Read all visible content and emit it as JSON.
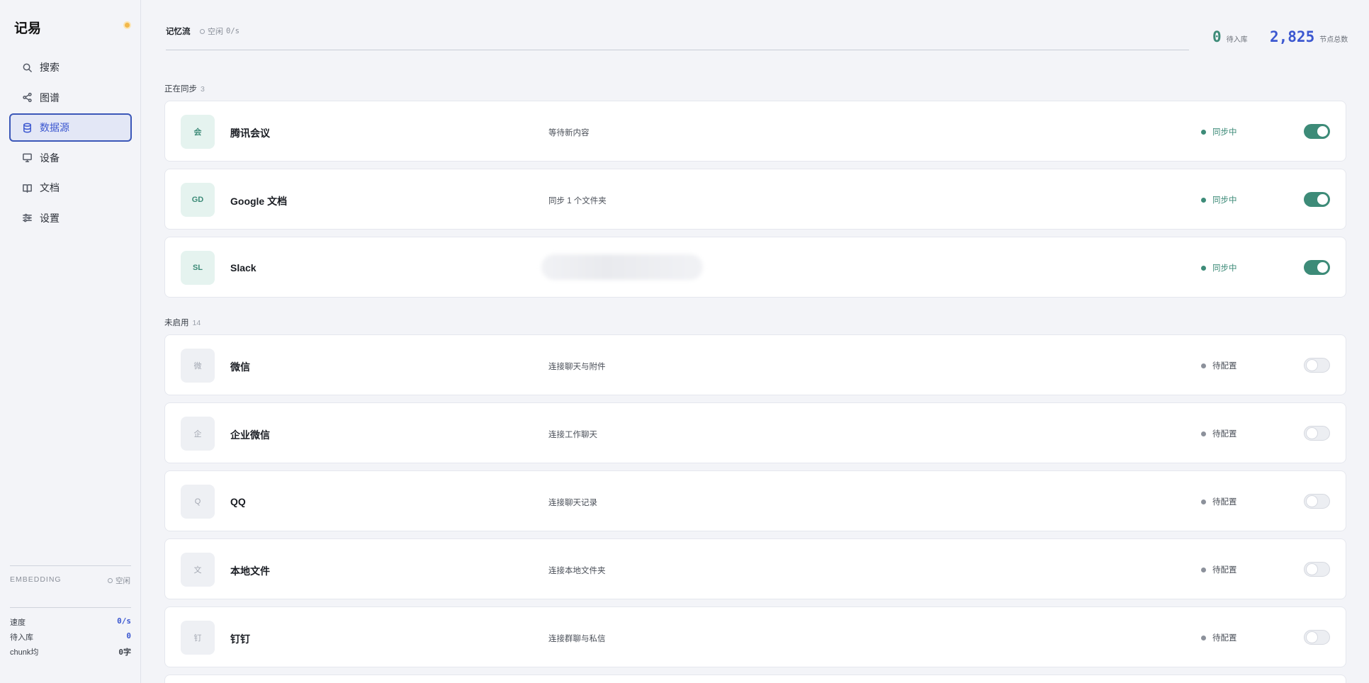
{
  "app": {
    "title": "记易"
  },
  "nav": [
    {
      "label": "搜索",
      "icon": "search-icon",
      "active": false
    },
    {
      "label": "图谱",
      "icon": "share-graph-icon",
      "active": false
    },
    {
      "label": "数据源",
      "icon": "database-icon",
      "active": true
    },
    {
      "label": "设备",
      "icon": "monitor-icon",
      "active": false
    },
    {
      "label": "文档",
      "icon": "book-icon",
      "active": false
    },
    {
      "label": "设置",
      "icon": "sliders-icon",
      "active": false
    }
  ],
  "embedding": {
    "label": "EMBEDDING",
    "status": "空闲",
    "stats": [
      {
        "label": "速度",
        "value": "0/s"
      },
      {
        "label": "待入库",
        "value": "0"
      },
      {
        "label": "chunk均",
        "value": "0字"
      }
    ]
  },
  "header": {
    "title": "记忆流",
    "status_label": "空闲",
    "status_rate": "0/s",
    "metrics": [
      {
        "value": "0",
        "label": "待入库",
        "color": "#3d8b78"
      },
      {
        "value": "2,825",
        "label": "节点总数",
        "color": "#3b57d0"
      }
    ]
  },
  "sections": {
    "syncing": {
      "title": "正在同步",
      "count": "3"
    },
    "disabled": {
      "title": "未启用",
      "count": "14"
    }
  },
  "sources_syncing": [
    {
      "logo": "会",
      "name": "腾讯会议",
      "desc": "等待新内容",
      "status": "同步中",
      "enabled": true
    },
    {
      "logo": "GD",
      "name": "Google 文档",
      "desc": "同步 1 个文件夹",
      "status": "同步中",
      "enabled": true
    },
    {
      "logo": "SL",
      "name": "Slack",
      "desc": "",
      "status": "同步中",
      "enabled": true,
      "desc_blurred": true
    }
  ],
  "sources_disabled": [
    {
      "logo": "微",
      "name": "微信",
      "desc": "连接聊天与附件",
      "status": "待配置",
      "enabled": false
    },
    {
      "logo": "企",
      "name": "企业微信",
      "desc": "连接工作聊天",
      "status": "待配置",
      "enabled": false
    },
    {
      "logo": "Q",
      "name": "QQ",
      "desc": "连接聊天记录",
      "status": "待配置",
      "enabled": false
    },
    {
      "logo": "文",
      "name": "本地文件",
      "desc": "连接本地文件夹",
      "status": "待配置",
      "enabled": false
    },
    {
      "logo": "钉",
      "name": "钉钉",
      "desc": "连接群聊与私信",
      "status": "待配置",
      "enabled": false
    }
  ],
  "colors": {
    "accent": "#3b57d0",
    "sync_green": "#3d8b78",
    "brand_dot": "#f2b84b"
  }
}
